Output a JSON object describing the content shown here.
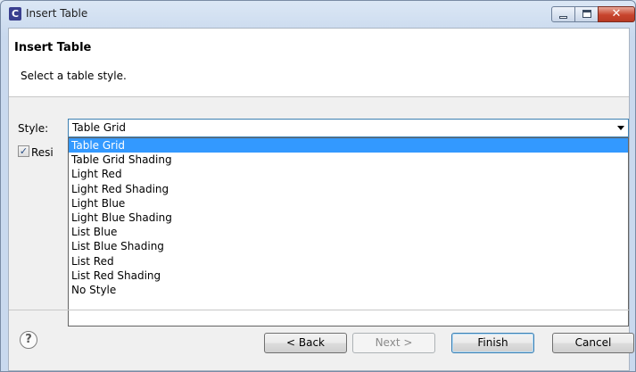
{
  "window": {
    "icon_letter": "C",
    "title": "Insert Table",
    "minimize_symbol": "",
    "maximize_symbol": "",
    "close_symbol": "✕"
  },
  "header": {
    "title": "Insert Table",
    "subtitle": "Select a table style."
  },
  "style": {
    "label": "Style:",
    "selected": "Table Grid",
    "options": [
      "Table Grid",
      "Table Grid Shading",
      "Light Red",
      "Light Red Shading",
      "Light Blue",
      "Light Blue Shading",
      "List Blue",
      "List Blue Shading",
      "List Red",
      "List Red Shading",
      "No Style"
    ]
  },
  "resize": {
    "checked": true,
    "label_visible": "Resi"
  },
  "footer": {
    "help_symbol": "?",
    "back_label": "< Back",
    "next_label": "Next >",
    "finish_label": "Finish",
    "cancel_label": "Cancel"
  },
  "colors": {
    "selection": "#3399ff",
    "focus_border": "#3c7fb1"
  }
}
